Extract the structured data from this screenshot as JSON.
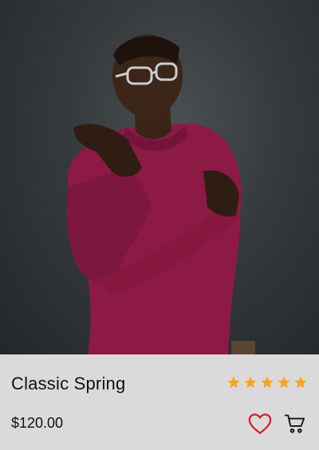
{
  "product": {
    "image_alt": "Model wearing a burgundy knit sweater",
    "title": "Classic Spring",
    "price": "$120.00",
    "rating": 5,
    "rating_max": 5
  },
  "icons": {
    "star": "star-icon",
    "favorite": "heart-icon",
    "cart": "cart-icon"
  },
  "colors": {
    "star": "#f5a623",
    "heart": "#e0182d",
    "info_background": "#dadada",
    "sweater": "#8c1a45"
  }
}
